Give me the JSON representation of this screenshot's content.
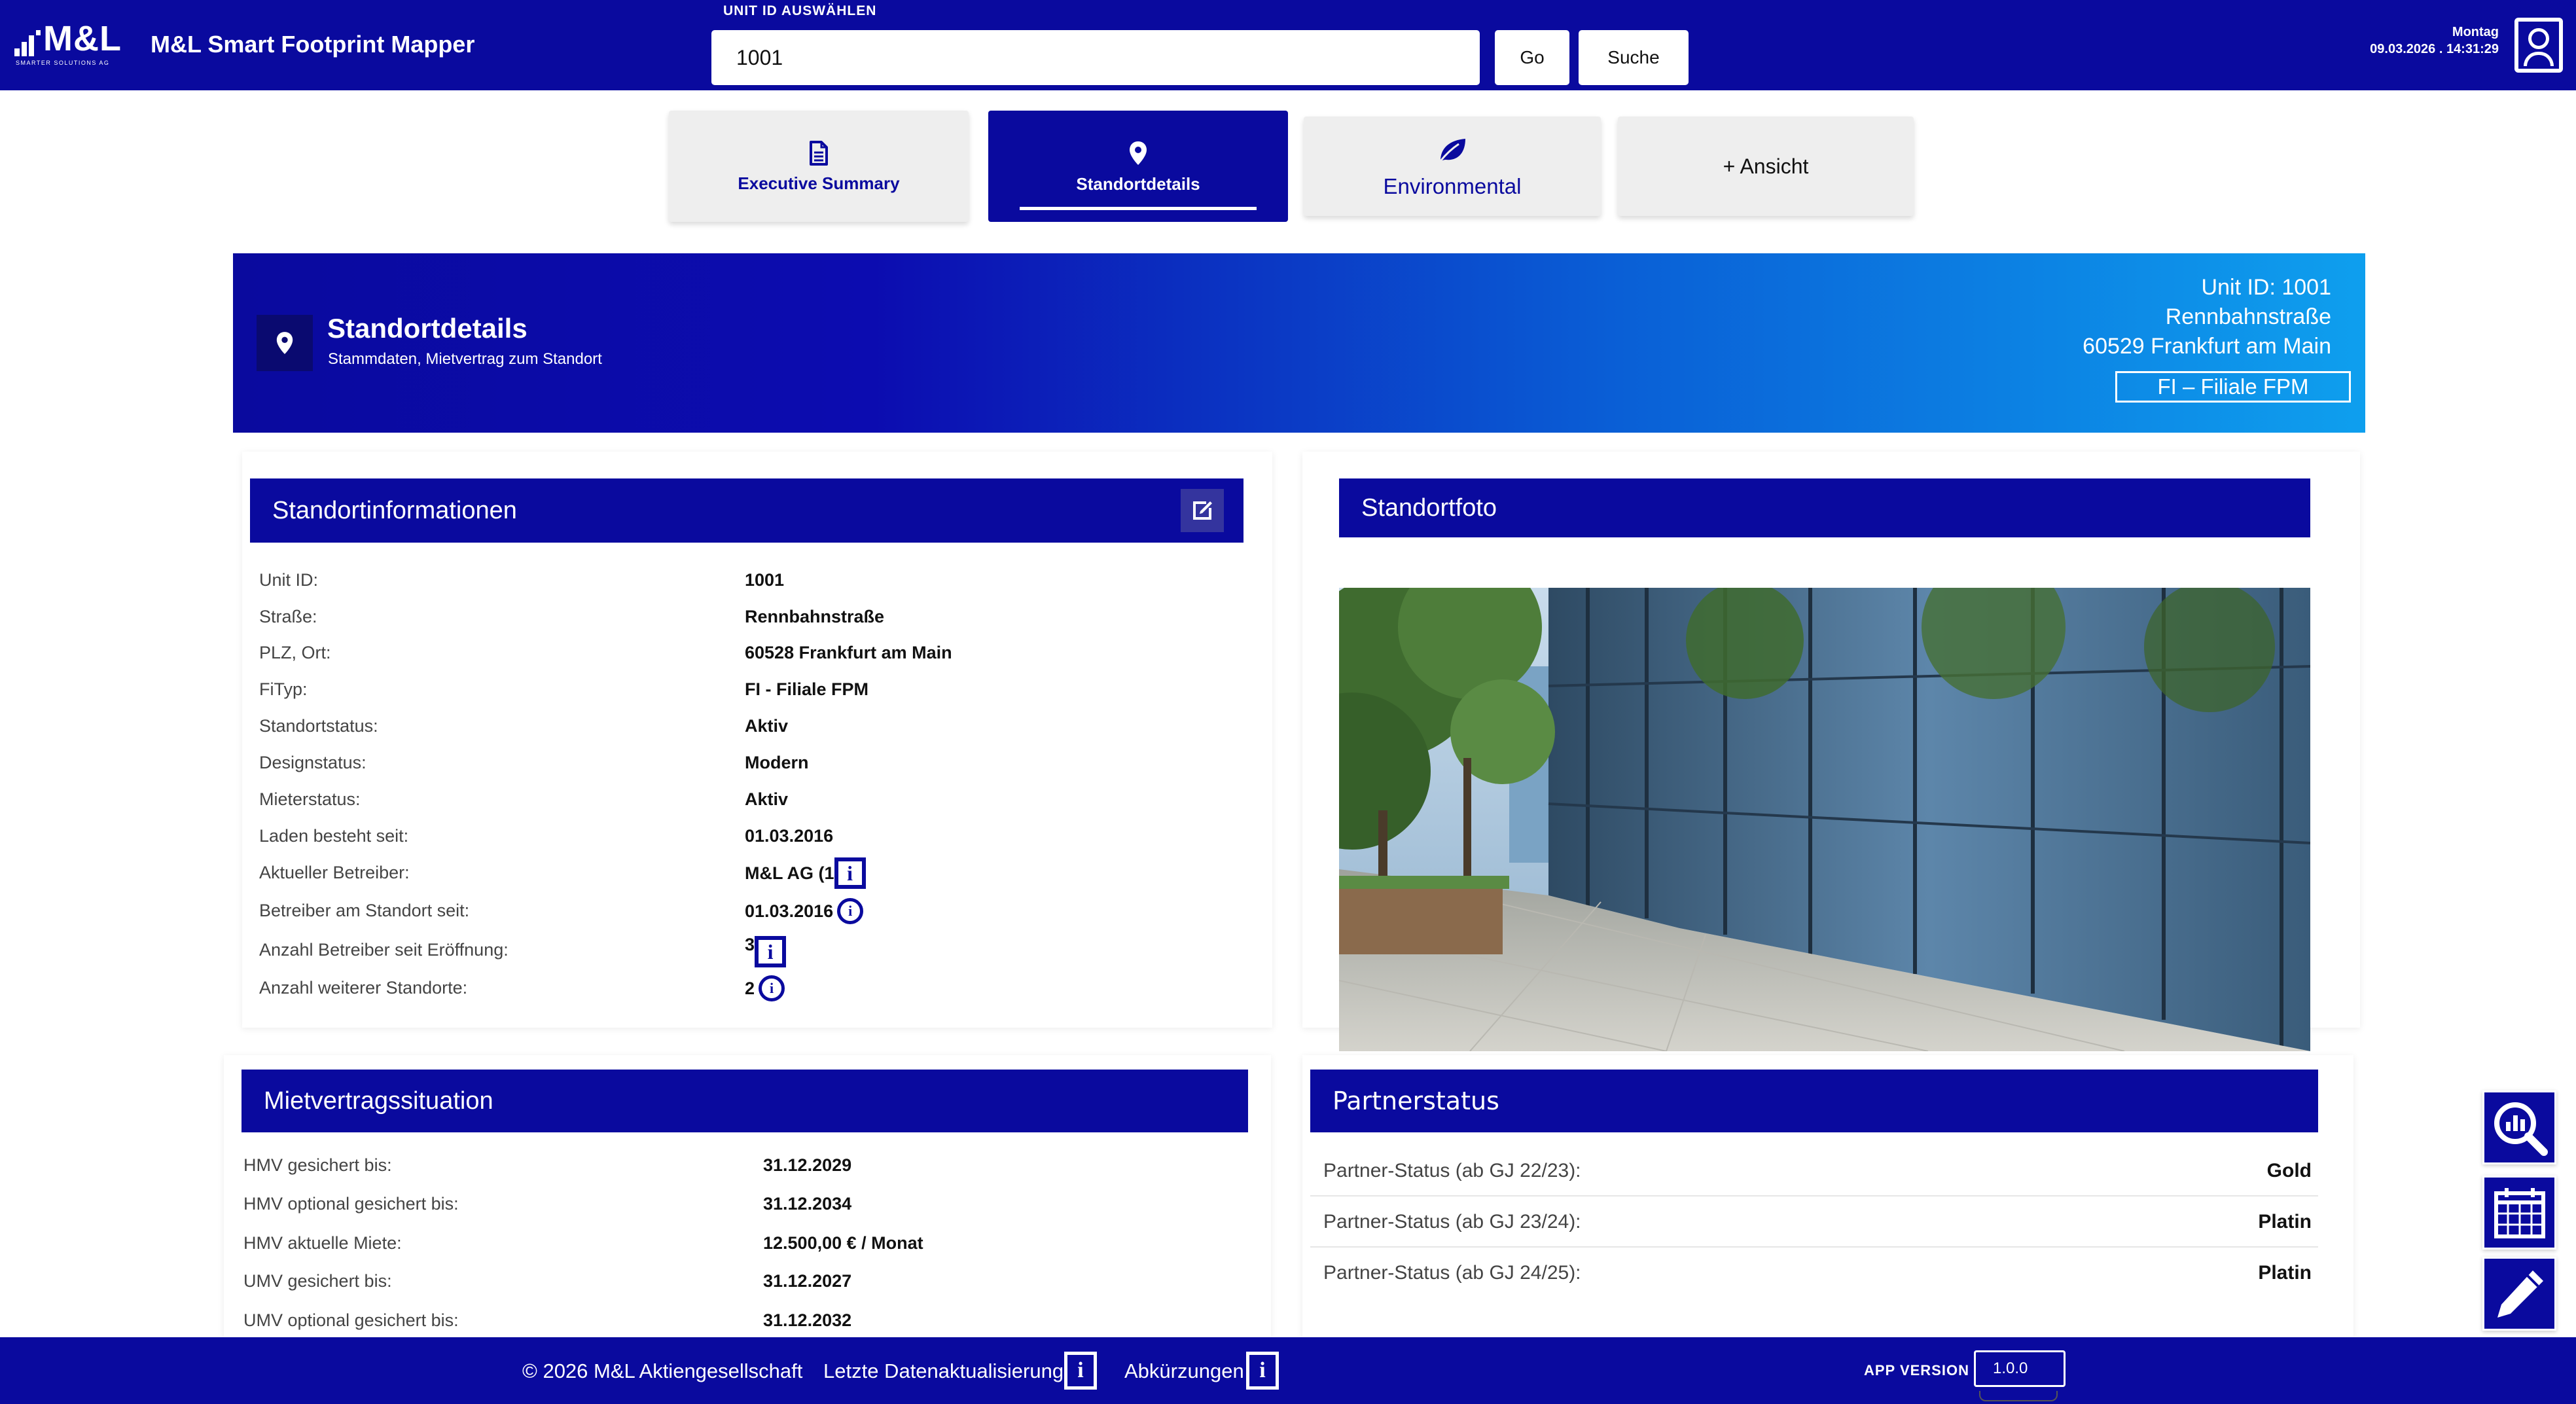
{
  "header": {
    "logo_text": "M&L",
    "logo_subtitle": "SMARTER SOLUTIONS AG",
    "app_title": "M&L Smart Footprint Mapper",
    "unit_label": "UNIT ID AUSWÄHLEN",
    "unit_value": "1001",
    "go_label": "Go",
    "search_label": "Suche",
    "weekday": "Montag",
    "datetime": "09.03.2026 . 14:31:29"
  },
  "tabs": [
    {
      "label": "Executive Summary",
      "icon": "document-icon"
    },
    {
      "label": "Standortdetails",
      "icon": "map-pin-icon",
      "active": true
    },
    {
      "label": "Environmental",
      "icon": "leaf-icon"
    },
    {
      "label": "+ Ansicht",
      "icon": ""
    }
  ],
  "banner": {
    "title": "Standortdetails",
    "subtitle": "Stammdaten, Mietvertrag zum Standort",
    "unit_id": "Unit ID: 1001",
    "street": "Rennbahnstraße",
    "city": "60529 Frankfurt am Main",
    "chip": "FI – Filiale FPM"
  },
  "standortinfo": {
    "title": "Standortinformationen",
    "rows": [
      {
        "label": "Unit ID:",
        "value": "1001"
      },
      {
        "label": "Straße:",
        "value": "Rennbahnstraße"
      },
      {
        "label": "PLZ, Ort:",
        "value": "60528 Frankfurt am Main"
      },
      {
        "label": "FiTyp:",
        "value": "FI - Filiale FPM"
      },
      {
        "label": "Standortstatus:",
        "value": "Aktiv"
      },
      {
        "label": "Designstatus:",
        "value": "Modern"
      },
      {
        "label": "Mieterstatus:",
        "value": "Aktiv"
      },
      {
        "label": "Laden besteht seit:",
        "value": "01.03.2016"
      },
      {
        "label": "Aktueller Betreiber:",
        "value": "M&L AG (1"
      },
      {
        "label": "Betreiber am Standort seit:",
        "value": "01.03.2016"
      },
      {
        "label": "Anzahl Betreiber seit Eröffnung:",
        "value": "3"
      },
      {
        "label": "Anzahl weiterer Standorte:",
        "value": "2"
      }
    ]
  },
  "standortfoto": {
    "title": "Standortfoto"
  },
  "mietvertrag": {
    "title": "Mietvertragssituation",
    "rows": [
      {
        "label": "HMV gesichert bis:",
        "value": "31.12.2029"
      },
      {
        "label": "HMV optional gesichert bis:",
        "value": "31.12.2034"
      },
      {
        "label": "HMV aktuelle Miete:",
        "value": "12.500,00 € / Monat"
      },
      {
        "label": "UMV gesichert bis:",
        "value": "31.12.2027"
      },
      {
        "label": "UMV optional gesichert bis:",
        "value": "31.12.2032"
      }
    ]
  },
  "partnerstatus": {
    "title": "Partnerstatus",
    "rows": [
      {
        "label": "Partner-Status (ab GJ 22/23):",
        "value": "Gold"
      },
      {
        "label": "Partner-Status (ab GJ 23/24):",
        "value": "Platin"
      },
      {
        "label": "Partner-Status (ab GJ 24/25):",
        "value": "Platin"
      }
    ]
  },
  "footer": {
    "copyright": "© 2026 M&L Aktiengesellschaft",
    "last_update": "Letzte Datenaktualisierung",
    "abbreviations": "Abkürzungen",
    "info_glyph": "i",
    "app_version_label": "APP VERSION",
    "app_version": "1.0.0"
  },
  "side_actions": [
    "analytics-search-icon",
    "calendar-icon",
    "pencil-icon"
  ],
  "colors": {
    "primary": "#0a0a9e",
    "banner_end": "#0e9fee",
    "white": "#ffffff"
  }
}
